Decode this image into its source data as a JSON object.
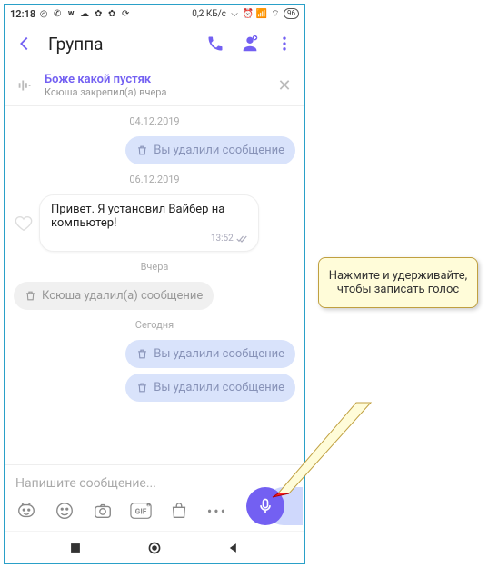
{
  "statusbar": {
    "time": "12:18",
    "net_text": "0,2 КБ/с",
    "battery": "96"
  },
  "header": {
    "title": "Группа"
  },
  "pinned": {
    "title": "Боже какой пустяк",
    "subtitle": "Ксюша закрепил(а) вчера"
  },
  "dates": {
    "d1": "04.12.2019",
    "d2": "06.12.2019",
    "d3": "Вчера",
    "d4": "Сегодня"
  },
  "messages": {
    "deleted_out": "Вы удалили сообщение",
    "incoming": "Привет. Я установил Вайбер на компьютер!",
    "incoming_time": "13:52",
    "deleted_in": "Ксюша удалил(а) сообщение"
  },
  "input": {
    "placeholder": "Напишите сообщение..."
  },
  "callout": {
    "text": "Нажмите и удерживайте, чтобы записать голос"
  }
}
